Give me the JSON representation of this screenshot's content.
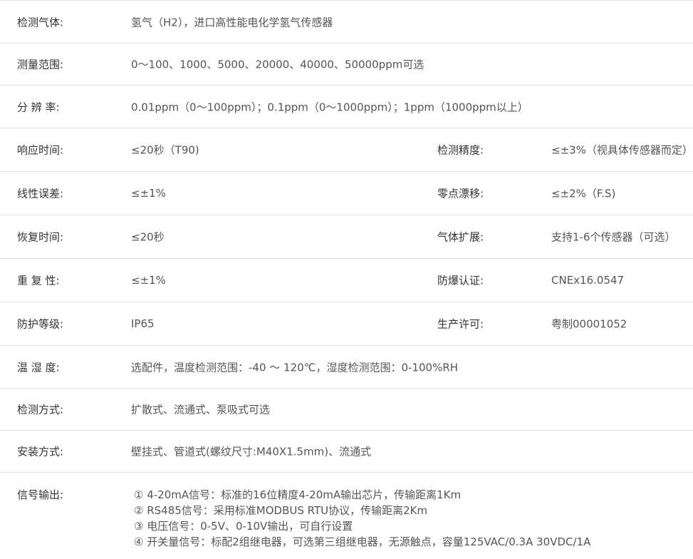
{
  "rows": [
    {
      "label": "检测气体:",
      "value": "氢气（H2），进口高性能电化学氢气传感器"
    },
    {
      "label": "测量范围:",
      "value": "0～100、1000、5000、20000、40000、50000ppm可选"
    },
    {
      "label": "分 辨 率:",
      "value": "0.01ppm（0～100ppm）；0.1ppm（0～1000ppm）；1ppm（1000ppm以上）"
    },
    {
      "label": "响应时间:",
      "value": "≤20秒（T90)",
      "label2": "检测精度:",
      "value2": "≤±3%（视具体传感器而定）"
    },
    {
      "label": "线性误差:",
      "value": "≤±1%",
      "label2": "零点漂移:",
      "value2": "≤±2%（F.S)"
    },
    {
      "label": "恢复时间:",
      "value": "≤20秒",
      "label2": "气体扩展:",
      "value2": "支持1-6个传感器（可选）"
    },
    {
      "label": "重 复 性:",
      "value": "≤±1%",
      "label2": "防爆认证:",
      "value2": "CNEx16.0547"
    },
    {
      "label": "防护等级:",
      "value": "IP65",
      "label2": "生产许可:",
      "value2": "粤制00001052"
    },
    {
      "label": "温 湿 度:",
      "value": "选配件，温度检测范围：-40 ～ 120℃，湿度检测范围：0-100%RH"
    },
    {
      "label": "检测方式:",
      "value": "扩散式、流通式、泵吸式可选"
    },
    {
      "label": "安装方式:",
      "value": "壁挂式、管道式(螺纹尺寸:M40X1.5mm)、流通式"
    }
  ],
  "signal_output": {
    "label": "信号输出:",
    "items": [
      "① 4-20mA信号：标准的16位精度4-20mA输出芯片，传输距离1Km",
      "② RS485信号：采用标准MODBUS RTU协议，传输距离2Km",
      "③ 电压信号：0-5V、0-10V输出，可自行设置",
      "④ 开关量信号：标配2组继电器，可选第三组继电器，无源触点，容量125VAC/0.3A 30VDC/1A"
    ]
  }
}
